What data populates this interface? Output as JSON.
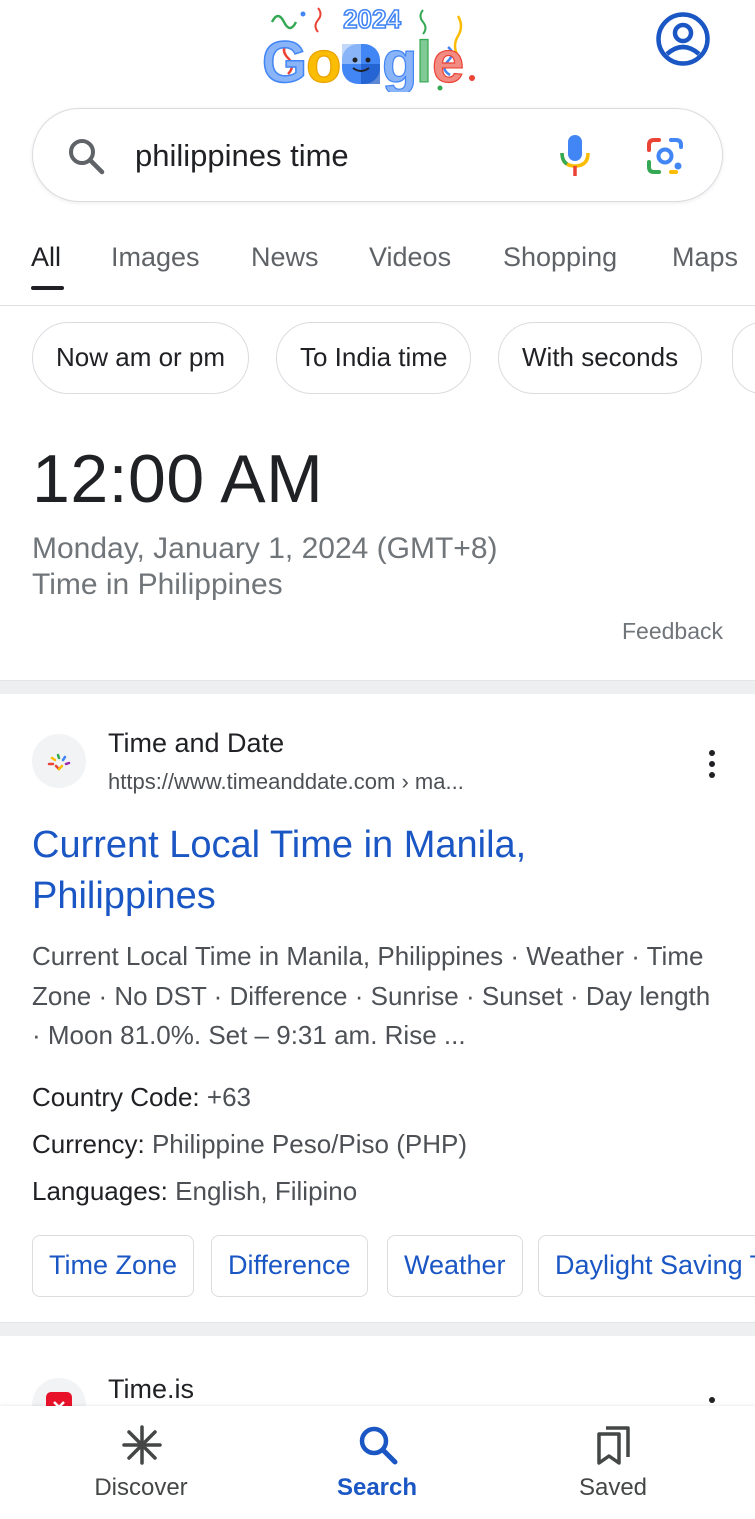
{
  "header": {
    "logo_year": "2024",
    "logo_word": "Google",
    "colors": {
      "blue": "#4285f4",
      "red": "#ea4335",
      "yellow": "#fbbc04",
      "green": "#34a853",
      "link": "#1a56c4"
    }
  },
  "search": {
    "query": "philippines time"
  },
  "tabs": [
    {
      "label": "All",
      "active": true
    },
    {
      "label": "Images"
    },
    {
      "label": "News"
    },
    {
      "label": "Videos"
    },
    {
      "label": "Shopping"
    },
    {
      "label": "Maps"
    }
  ],
  "chips": [
    {
      "label": "Now am or pm"
    },
    {
      "label": "To India time"
    },
    {
      "label": "With seconds"
    }
  ],
  "time_card": {
    "time": "12:00 AM",
    "date": "Monday, January 1, 2024 (GMT+8)",
    "place": "Time in Philippines",
    "feedback": "Feedback"
  },
  "results": [
    {
      "site_name": "Time and Date",
      "url": "https://www.timeanddate.com › ma...",
      "title": "Current Local Time in Manila, Philippines",
      "snippet": "Current Local Time in Manila, Philippines · Weather · Time Zone · No DST · Difference · Sunrise · Sunset · Day length · Moon 81.0%. Set – 9:31 am. Rise ...",
      "facts": [
        {
          "label": "Country Code:",
          "value": "+63"
        },
        {
          "label": "Currency:",
          "value": "Philippine Peso/Piso (PHP)"
        },
        {
          "label": "Languages:",
          "value": "English, Filipino"
        }
      ],
      "sitelinks": [
        "Time Zone",
        "Difference",
        "Weather",
        "Daylight Saving T"
      ]
    },
    {
      "site_name": "Time.is"
    }
  ],
  "bottom_nav": [
    {
      "label": "Discover",
      "icon": "asterisk-icon"
    },
    {
      "label": "Search",
      "icon": "search-icon",
      "active": true
    },
    {
      "label": "Saved",
      "icon": "bookmarks-icon"
    }
  ]
}
